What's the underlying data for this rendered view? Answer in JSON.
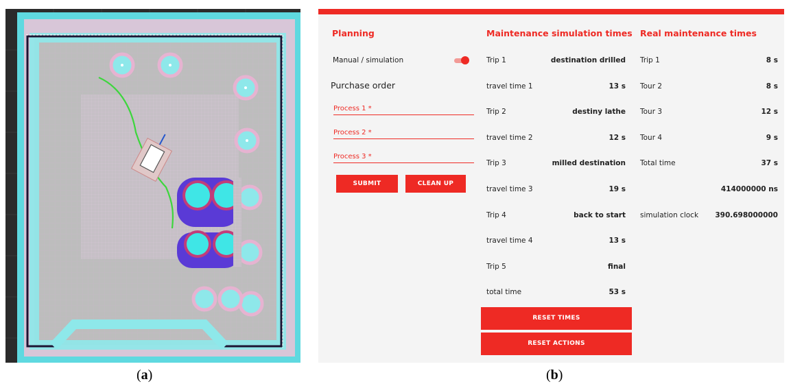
{
  "captions": {
    "a": "a",
    "b": "b"
  },
  "planning": {
    "title": "Planning",
    "toggle_label": "Manual / simulation",
    "purchase_order": "Purchase order",
    "fields": [
      "Process 1 *",
      "Process 2 *",
      "Process 3 *"
    ],
    "submit_label": "SUBMIT",
    "cleanup_label": "CLEAN UP"
  },
  "simulation": {
    "title": "Maintenance simulation times",
    "rows": [
      {
        "label": "Trip 1",
        "value": "destination drilled"
      },
      {
        "label": "travel time 1",
        "value": "13 s"
      },
      {
        "label": "Trip 2",
        "value": "destiny lathe"
      },
      {
        "label": "travel time 2",
        "value": "12 s"
      },
      {
        "label": "Trip 3",
        "value": "milled destination"
      },
      {
        "label": "travel time 3",
        "value": "19 s"
      },
      {
        "label": "Trip 4",
        "value": "back to start"
      },
      {
        "label": "travel time 4",
        "value": "13 s"
      },
      {
        "label": "Trip 5",
        "value": "final"
      },
      {
        "label": "total time",
        "value": "53 s"
      }
    ],
    "reset_times_label": "RESET TIMES",
    "reset_actions_label": "RESET ACTIONS"
  },
  "real": {
    "title": "Real maintenance times",
    "rows": [
      {
        "label": "Trip 1",
        "value": "8 s"
      },
      {
        "label": "Tour 2",
        "value": "8 s"
      },
      {
        "label": "Tour 3",
        "value": "12 s"
      },
      {
        "label": "Tour 4",
        "value": "9 s"
      },
      {
        "label": "Total time",
        "value": "37 s"
      },
      {
        "label": "",
        "value": "414000000 ns"
      },
      {
        "label": "simulation clock",
        "value": "390.698000000"
      }
    ]
  },
  "colors": {
    "accent": "#ee2a24",
    "panel_bg": "#f4f4f4",
    "path": "#3dd63d",
    "obstacle": "#3fe6e6",
    "lethal": "#5a3ad6"
  }
}
